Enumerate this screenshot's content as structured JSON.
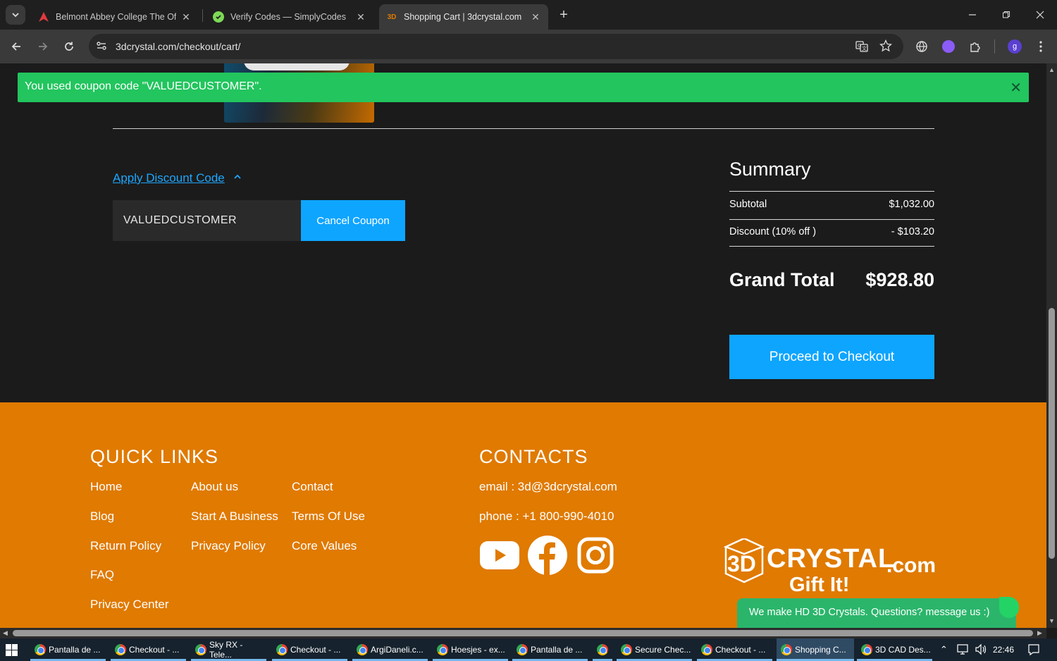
{
  "browser": {
    "tabs": [
      {
        "title": "Belmont Abbey College The Offi",
        "icon": "belmont-logo-icon",
        "active": false
      },
      {
        "title": "Verify Codes — SimplyCodes",
        "icon": "simplycodes-icon",
        "active": false
      },
      {
        "title": "Shopping Cart | 3dcrystal.com",
        "icon": "3d-icon",
        "active": true
      }
    ],
    "url": "3dcrystal.com/checkout/cart/",
    "profile_initial": "g"
  },
  "notice": {
    "message": "You used coupon code \"VALUEDCUSTOMER\".",
    "color": "#22c55e"
  },
  "discount": {
    "toggle_label": "Apply Discount Code",
    "code_value": "VALUEDCUSTOMER",
    "cancel_label": "Cancel Coupon"
  },
  "summary": {
    "title": "Summary",
    "subtotal_label": "Subtotal",
    "subtotal_value": "$1,032.00",
    "discount_label": "Discount (10% off )",
    "discount_value": "- $103.20",
    "grand_total_label": "Grand Total",
    "grand_total_value": "$928.80",
    "checkout_label": "Proceed to Checkout"
  },
  "footer": {
    "quick_links_title": "QUICK LINKS",
    "links": [
      {
        "label": "Home"
      },
      {
        "label": "About us"
      },
      {
        "label": "Contact"
      },
      {
        "label": "Blog"
      },
      {
        "label": "Start A Business"
      },
      {
        "label": "Terms Of Use"
      },
      {
        "label": "Return Policy"
      },
      {
        "label": "Privacy Policy"
      },
      {
        "label": "Core Values"
      },
      {
        "label": "FAQ"
      },
      {
        "label": "Privacy Center"
      }
    ],
    "contacts_title": "CONTACTS",
    "email": "email : 3d@3dcrystal.com",
    "phone": "phone : +1 800-990-4010",
    "social": [
      "youtube-icon",
      "facebook-icon",
      "instagram-icon"
    ],
    "logo_text": {
      "mark": "3D",
      "name": "CRYSTAL",
      "tld": ".com",
      "tagline": "Gift It!"
    },
    "background": "#e07a00"
  },
  "chat": {
    "message": "We make HD 3D Crystals. Questions? message us :)"
  },
  "taskbar": {
    "apps": [
      {
        "label": "Pantalla de ..."
      },
      {
        "label": "Checkout - ..."
      },
      {
        "label": "Sky RX - Tele..."
      },
      {
        "label": "Checkout - ..."
      },
      {
        "label": "ArgiDaneli.c..."
      },
      {
        "label": "Hoesjes - ex..."
      },
      {
        "label": "Pantalla de ..."
      },
      {
        "label": ""
      },
      {
        "label": "Secure Chec..."
      },
      {
        "label": "Checkout - ..."
      },
      {
        "label": "Shopping C..."
      },
      {
        "label": "3D CAD Des..."
      }
    ],
    "time": "22:46"
  },
  "accent": "#0ea5ff"
}
